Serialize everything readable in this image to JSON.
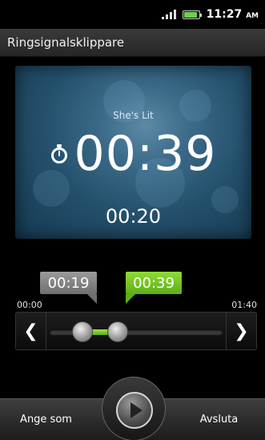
{
  "status_bar": {
    "time": "11:27",
    "ampm": "AM"
  },
  "app": {
    "title": "Ringsignalsklippare"
  },
  "player": {
    "song_title": "She's Lit",
    "clip_length": "00:39",
    "current_position": "00:20"
  },
  "trim": {
    "start_marker": "00:19",
    "end_marker": "00:39",
    "track_start_label": "00:00",
    "track_end_label": "01:40",
    "start_fraction": 0.19,
    "end_fraction": 0.39
  },
  "colors": {
    "accent_green": "#6cc61f",
    "display_blue": "#2b5a78"
  },
  "icons": {
    "signal": "signal-icon",
    "battery": "battery-icon",
    "stopwatch": "stopwatch-icon",
    "prev": "chevron-left-icon",
    "next": "chevron-right-icon",
    "play": "play-icon"
  },
  "toolbar": {
    "set_as_label": "Ange som",
    "quit_label": "Avsluta"
  }
}
